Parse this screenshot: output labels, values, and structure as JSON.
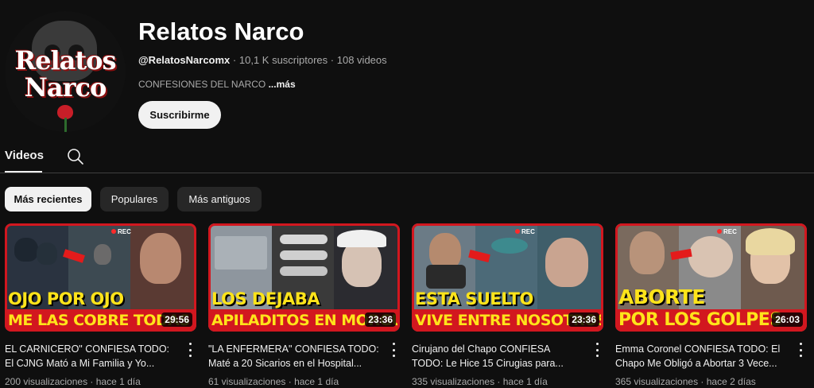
{
  "channel": {
    "logo_line1": "Relatos",
    "logo_line2": "Narco",
    "name": "Relatos Narco",
    "handle": "@RelatosNarcomx",
    "subscribers": "10,1 K suscriptores",
    "videos_count": "108 videos",
    "separator": "·",
    "description": "CONFESIONES DEL NARCO",
    "more_label": "...más",
    "subscribe_label": "Suscribirme"
  },
  "tabs": {
    "videos_label": "Videos",
    "search_icon": "search-icon"
  },
  "filters": [
    {
      "label": "Más recientes",
      "active": true
    },
    {
      "label": "Populares",
      "active": false
    },
    {
      "label": "Más antiguos",
      "active": false
    }
  ],
  "videos": [
    {
      "thumb_line1": "OJO POR OJO",
      "thumb_line2": "ME LAS COBRE TODAS",
      "rec": "REC",
      "duration": "29:56",
      "title_line1": "EL CARNICERO\" CONFIESA TODO:",
      "title_line2": "El CJNG Mató a Mi Familia y Yo...",
      "views": "200 visualizaciones",
      "age": "hace 1 día"
    },
    {
      "thumb_line1": "LOS DEJABA",
      "thumb_line2": "APILADITOS EN MORGUE",
      "rec": "",
      "duration": "23:36",
      "title_line1": "\"LA ENFERMERA\" CONFIESA TODO:",
      "title_line2": "Maté a 20 Sicarios en el Hospital...",
      "views": "61 visualizaciones",
      "age": "hace 1 día"
    },
    {
      "thumb_line1": "ESTA SUELTO",
      "thumb_line2": "VIVE ENTRE NOSOTROS",
      "rec": "REC",
      "duration": "23:36",
      "title_line1": "Cirujano del Chapo CONFIESA",
      "title_line2": "TODO: Le Hice 15 Cirugias para...",
      "views": "335 visualizaciones",
      "age": "hace 1 día"
    },
    {
      "thumb_line1": "ABORTE",
      "thumb_line2": "POR LOS GOLPES",
      "rec": "REC",
      "duration": "26:03",
      "title_line1": "Emma Coronel CONFIESA TODO: El",
      "title_line2": "Chapo Me Obligó a Abortar 3 Vece...",
      "views": "365 visualizaciones",
      "age": "hace 2 días"
    }
  ],
  "colors": {
    "background": "#0f0f0f",
    "thumb_red": "#d2171f",
    "thumb_yellow": "#ffe41a",
    "secondary_text": "#aaaaaa"
  }
}
